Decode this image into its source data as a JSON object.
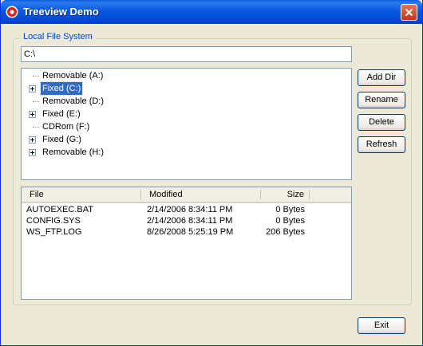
{
  "window": {
    "title": "Treeview Demo"
  },
  "group": {
    "label": "Local File System"
  },
  "path": {
    "value": "C:\\"
  },
  "tree": {
    "items": [
      {
        "label": "Removable (A:)",
        "expandable": false,
        "selected": false
      },
      {
        "label": "Fixed (C:)",
        "expandable": true,
        "selected": true
      },
      {
        "label": "Removable (D:)",
        "expandable": false,
        "selected": false
      },
      {
        "label": "Fixed (E:)",
        "expandable": true,
        "selected": false
      },
      {
        "label": "CDRom (F:)",
        "expandable": false,
        "selected": false
      },
      {
        "label": "Fixed (G:)",
        "expandable": true,
        "selected": false
      },
      {
        "label": "Removable (H:)",
        "expandable": true,
        "selected": false
      }
    ]
  },
  "list": {
    "columns": {
      "file": "File",
      "modified": "Modified",
      "size": "Size"
    },
    "rows": [
      {
        "file": "AUTOEXEC.BAT",
        "modified": "2/14/2006 8:34:11 PM",
        "size": "0 Bytes"
      },
      {
        "file": "CONFIG.SYS",
        "modified": "2/14/2006 8:34:11 PM",
        "size": "0 Bytes"
      },
      {
        "file": "WS_FTP.LOG",
        "modified": "8/26/2008 5:25:19 PM",
        "size": "206 Bytes"
      }
    ]
  },
  "buttons": {
    "add_dir": "Add Dir",
    "rename": "Rename",
    "delete": "Delete",
    "refresh": "Refresh",
    "exit": "Exit"
  },
  "colors": {
    "titlebar": "#0a58e0",
    "selection": "#316ac5",
    "group_label": "#0046d5",
    "close": "#c2361b"
  }
}
